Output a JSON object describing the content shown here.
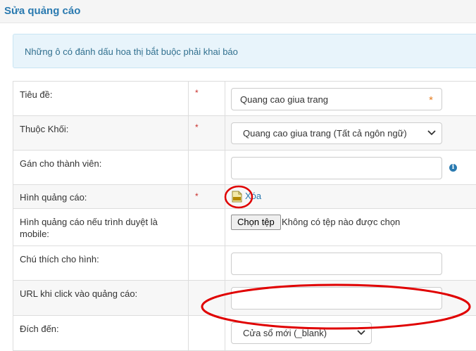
{
  "header": {
    "title": "Sửa quảng cáo"
  },
  "notice": {
    "text": "Những ô có đánh dấu hoa thị bắt buộc phải khai báo"
  },
  "form": {
    "title_label": "Tiêu đề:",
    "title_value": "Quang cao giua trang",
    "block_label": "Thuộc Khối:",
    "block_value": "Quang cao giua trang (Tất cả ngôn ngữ)",
    "member_label": "Gán cho thành viên:",
    "member_value": "",
    "image_label": "Hình quảng cáo:",
    "image_delete": "Xóa",
    "mobile_label": "Hình quảng cáo nếu trình duyệt là mobile:",
    "choose_file": "Chọn tệp",
    "no_file": "Không có tệp nào được chọn",
    "caption_label": "Chú thích cho hình:",
    "caption_value": "",
    "url_label": "URL khi click vào quảng cáo:",
    "url_value": "",
    "target_label": "Đích đến:",
    "target_value": "Cửa sổ mới (_blank)",
    "required_mark": "*"
  },
  "colors": {
    "accent": "#2a7ab0",
    "required": "#c9302c",
    "annotation": "#e00000"
  },
  "icons": {
    "info": "info-icon",
    "file": "jpg-file-icon",
    "chevron": "chevron-down-icon"
  }
}
